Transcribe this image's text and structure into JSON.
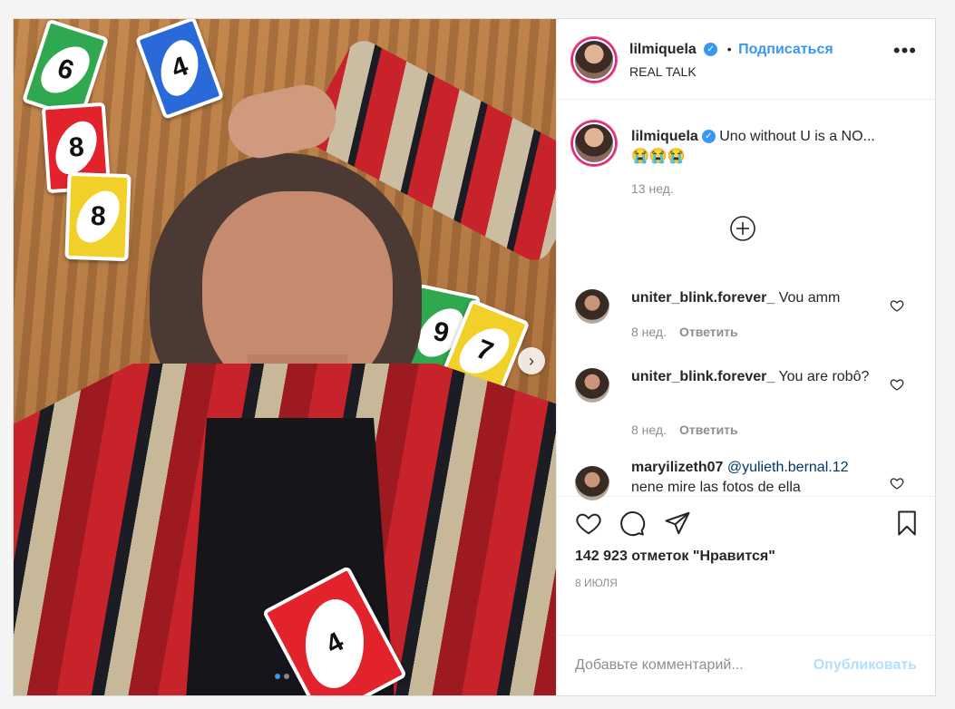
{
  "post": {
    "author": {
      "username": "lilmiquela",
      "verified": true,
      "follow_label": "Подписаться",
      "separator": "•",
      "subtitle": "REAL TALK"
    },
    "caption": {
      "username": "lilmiquela",
      "text": "Uno without U is a NO...",
      "emoji": "😭😭😭",
      "time": "13 нед."
    },
    "comments": [
      {
        "username": "uniter_blink.forever_",
        "text": "Vou amm",
        "time": "8 нед.",
        "reply_label": "Ответить"
      },
      {
        "username": "uniter_blink.forever_",
        "text": "You are robô?",
        "time": "8 нед.",
        "reply_label": "Ответить"
      },
      {
        "username": "maryilizeth07",
        "mention": "@yulieth.bernal.12",
        "text": "nene mire las fotos de ella"
      }
    ],
    "likes_text": "142 923 отметок \"Нравится\"",
    "date": "8 ИЮЛЯ",
    "add_comment": {
      "placeholder": "Добавьте комментарий...",
      "publish_label": "Опубликовать"
    },
    "carousel": {
      "slides": 2,
      "active_slide": 1
    }
  },
  "photo_cards": [
    {
      "value": "6",
      "color": "#2fa84f"
    },
    {
      "value": "4",
      "color": "#2a6ad8"
    },
    {
      "value": "8",
      "color": "#e2232b"
    },
    {
      "value": "8",
      "color": "#f1d129"
    },
    {
      "value": "9",
      "color": "#2fa84f"
    },
    {
      "value": "7",
      "color": "#f1d129"
    },
    {
      "value": "4",
      "color": "#e2232b"
    }
  ],
  "colors": {
    "accent": "#3897f0",
    "text": "#262626",
    "muted": "#8e8e8e",
    "publish_disabled": "#b2dffc"
  }
}
